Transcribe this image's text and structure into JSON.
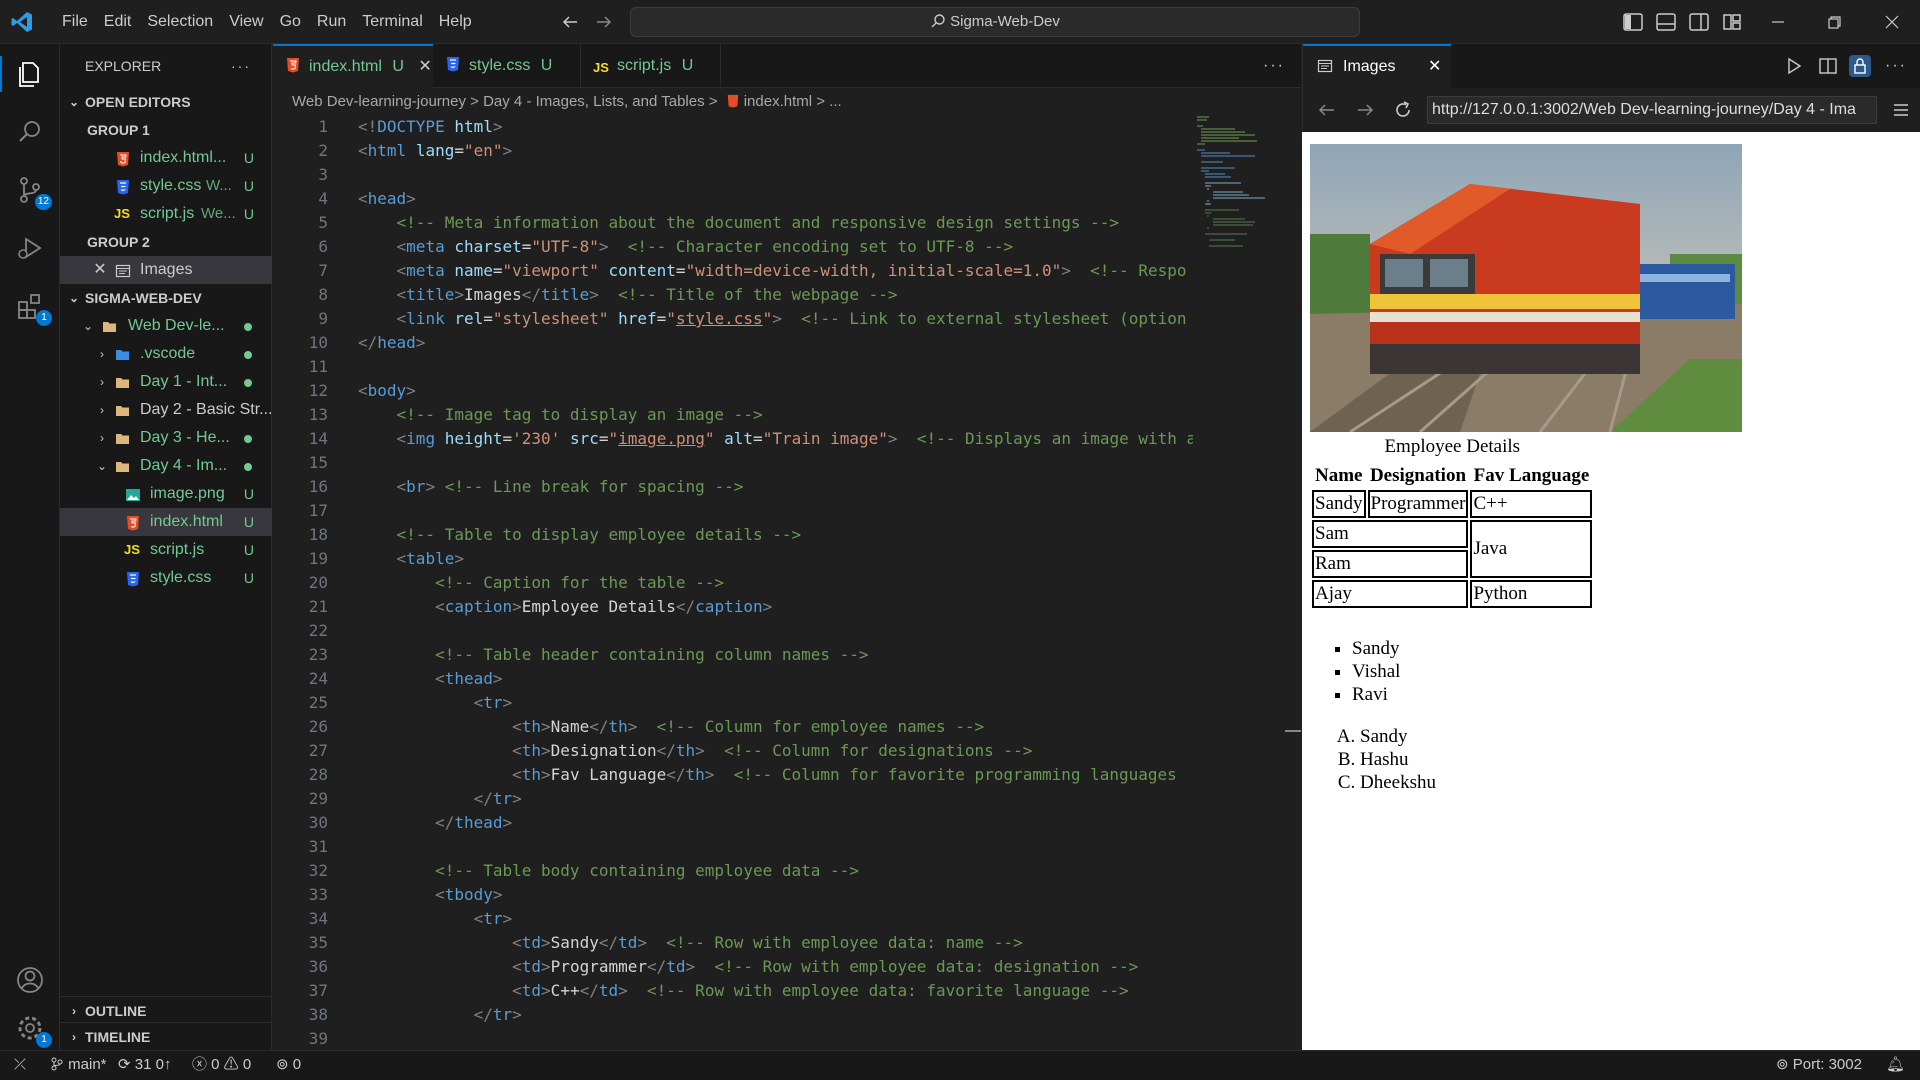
{
  "titlebar": {
    "menus": [
      "File",
      "Edit",
      "Selection",
      "View",
      "Go",
      "Run",
      "Terminal",
      "Help"
    ],
    "search": "Sigma-Web-Dev"
  },
  "activity": {
    "scm_badge": "12",
    "ext_badge": "1",
    "settings_badge": "1"
  },
  "sidebar": {
    "title": "EXPLORER",
    "open_editors": "OPEN EDITORS",
    "group1": "GROUP 1",
    "group1_files": [
      {
        "name": "index.html...",
        "status": "U"
      },
      {
        "name": "style.css",
        "desc": "W...",
        "status": "U"
      },
      {
        "name": "script.js",
        "desc": "We...",
        "status": "U"
      }
    ],
    "group2": "GROUP 2",
    "group2_files": [
      {
        "name": "Images"
      }
    ],
    "project": "SIGMA-WEB-DEV",
    "tree": {
      "root": "Web Dev-le...",
      "vscode": ".vscode",
      "day1": "Day 1 - Int...",
      "day2": "Day 2 - Basic Str...",
      "day3": "Day 3 - He...",
      "day4": "Day 4 - Im...",
      "files": [
        {
          "name": "image.png",
          "status": "U"
        },
        {
          "name": "index.html",
          "status": "U"
        },
        {
          "name": "script.js",
          "status": "U"
        },
        {
          "name": "style.css",
          "status": "U"
        }
      ]
    },
    "outline": "OUTLINE",
    "timeline": "TIMELINE"
  },
  "editor": {
    "tabs": [
      {
        "name": "index.html",
        "status": "U"
      },
      {
        "name": "style.css",
        "status": "U"
      },
      {
        "name": "script.js",
        "status": "U"
      }
    ],
    "breadcrumb": [
      "Web Dev-learning-journey",
      ">",
      "Day 4 - Images, Lists, and Tables",
      ">",
      "index.html",
      ">",
      "..."
    ]
  },
  "preview": {
    "tab": "Images",
    "url": "http://127.0.0.1:3002/Web Dev-learning-journey/Day 4 - Ima",
    "caption": "Employee Details",
    "headers": [
      "Name",
      "Designation",
      "Fav Language"
    ],
    "rows": {
      "r1": [
        "Sandy",
        "Programmer",
        "C++"
      ],
      "sam": "Sam",
      "ram": "Ram",
      "java": "Java",
      "ajay": "Ajay",
      "python": "Python"
    },
    "ul": [
      "Sandy",
      "Vishal",
      "Ravi"
    ],
    "ol": [
      "Sandy",
      "Hashu",
      "Dheekshu"
    ]
  },
  "status": {
    "branch": "main*",
    "sync": "31 0↑",
    "errors": "0",
    "warnings": "0",
    "ports": "0",
    "port": "Port: 3002"
  }
}
